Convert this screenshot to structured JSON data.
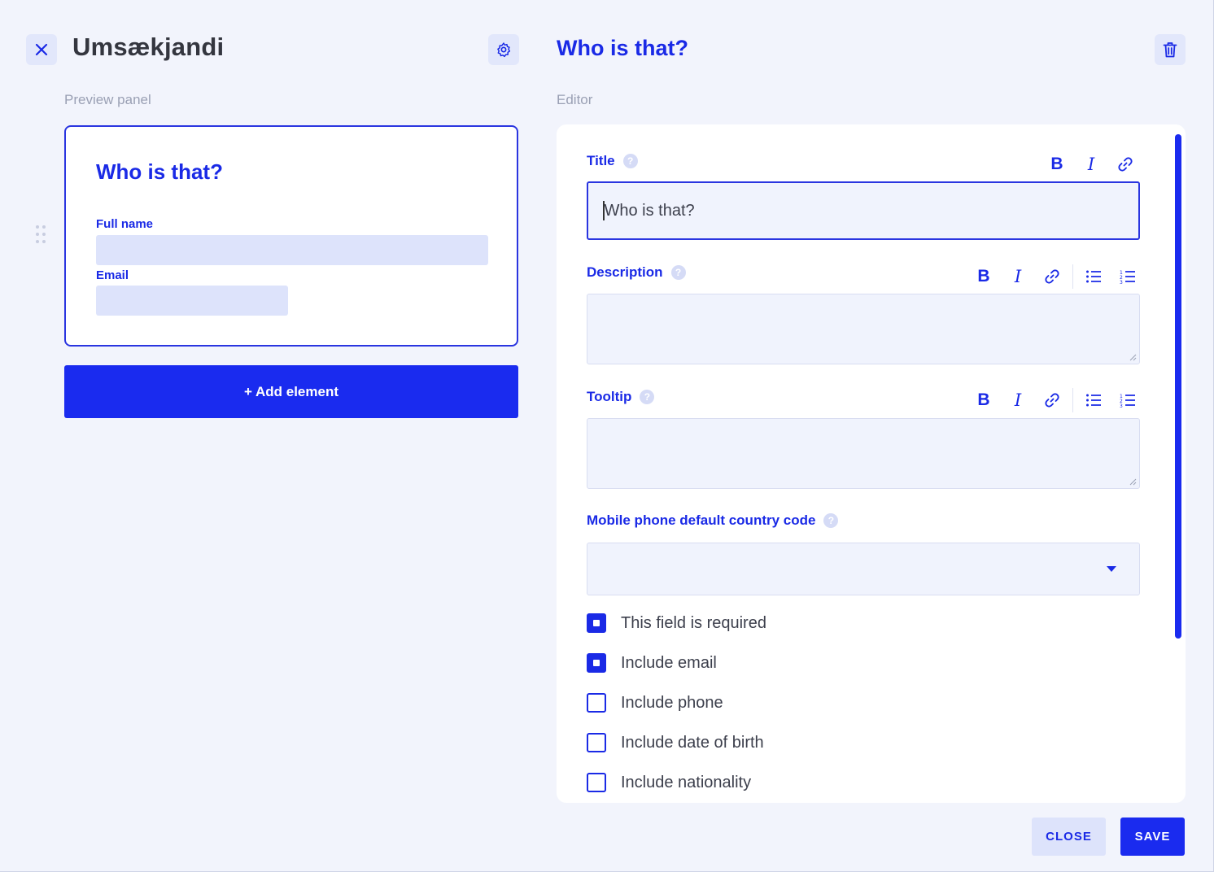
{
  "header": {
    "title": "Umsækjandi",
    "editor_title": "Who is that?"
  },
  "preview": {
    "section_label": "Preview panel",
    "card_title": "Who is that?",
    "fields": [
      {
        "label": "Full name"
      },
      {
        "label": "Email"
      }
    ],
    "add_button_label": "+ Add element"
  },
  "editor": {
    "section_label": "Editor",
    "title_field": {
      "label": "Title",
      "help": "?",
      "value": "Who is that?",
      "toolbar": [
        "B",
        "I"
      ]
    },
    "description_field": {
      "label": "Description",
      "help": "?",
      "value": "",
      "toolbar": [
        "B",
        "I"
      ]
    },
    "tooltip_field": {
      "label": "Tooltip",
      "help": "?",
      "value": "",
      "toolbar": [
        "B",
        "I"
      ]
    },
    "country_code_field": {
      "label": "Mobile phone default country code",
      "help": "?",
      "selected": ""
    },
    "checkboxes": [
      {
        "label": "This field is required",
        "checked": true
      },
      {
        "label": "Include email",
        "checked": true
      },
      {
        "label": "Include phone",
        "checked": false
      },
      {
        "label": "Include date of birth",
        "checked": false
      },
      {
        "label": "Include nationality",
        "checked": false
      }
    ]
  },
  "footer": {
    "close_label": "CLOSE",
    "save_label": "SAVE"
  },
  "colors": {
    "accent": "#1a2bef",
    "accent_text": "#1a2ae6",
    "background": "#f2f4fc",
    "input_fill": "#f0f3fd",
    "soft_button": "#dde3fb"
  },
  "icons": {
    "close": "close-icon",
    "settings": "gear-icon",
    "delete": "trash-icon",
    "drag": "drag-handle-icon",
    "link": "link-icon",
    "bullet_list": "bullet-list-icon",
    "numbered_list": "numbered-list-icon",
    "help": "help-icon",
    "dropdown": "chevron-down-icon"
  }
}
